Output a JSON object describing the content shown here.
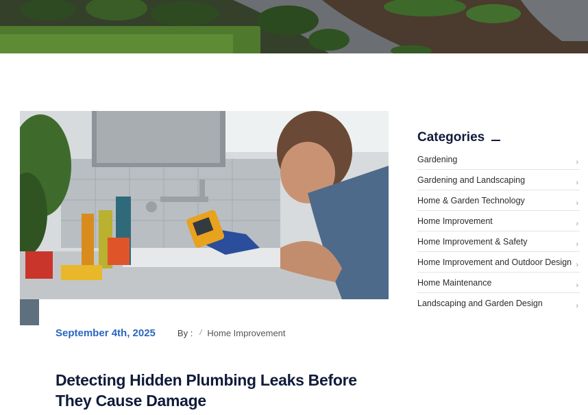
{
  "post": {
    "date": "September 4th, 2025",
    "by_label": "By :",
    "separator": "/",
    "category": "Home Improvement",
    "title": "Detecting Hidden Plumbing Leaks Before They Cause Damage"
  },
  "sidebar": {
    "title": "Categories",
    "items": [
      {
        "label": "Gardening"
      },
      {
        "label": "Gardening and Landscaping"
      },
      {
        "label": "Home & Garden Technology"
      },
      {
        "label": "Home Improvement"
      },
      {
        "label": "Home Improvement & Safety"
      },
      {
        "label": "Home Improvement and Outdoor Design"
      },
      {
        "label": "Home Maintenance"
      },
      {
        "label": "Landscaping and Garden Design"
      }
    ]
  },
  "colors": {
    "accent": "#2a66c0",
    "heading": "#101b3a"
  },
  "icons": {
    "category_arrow": "chevron-right-icon"
  }
}
